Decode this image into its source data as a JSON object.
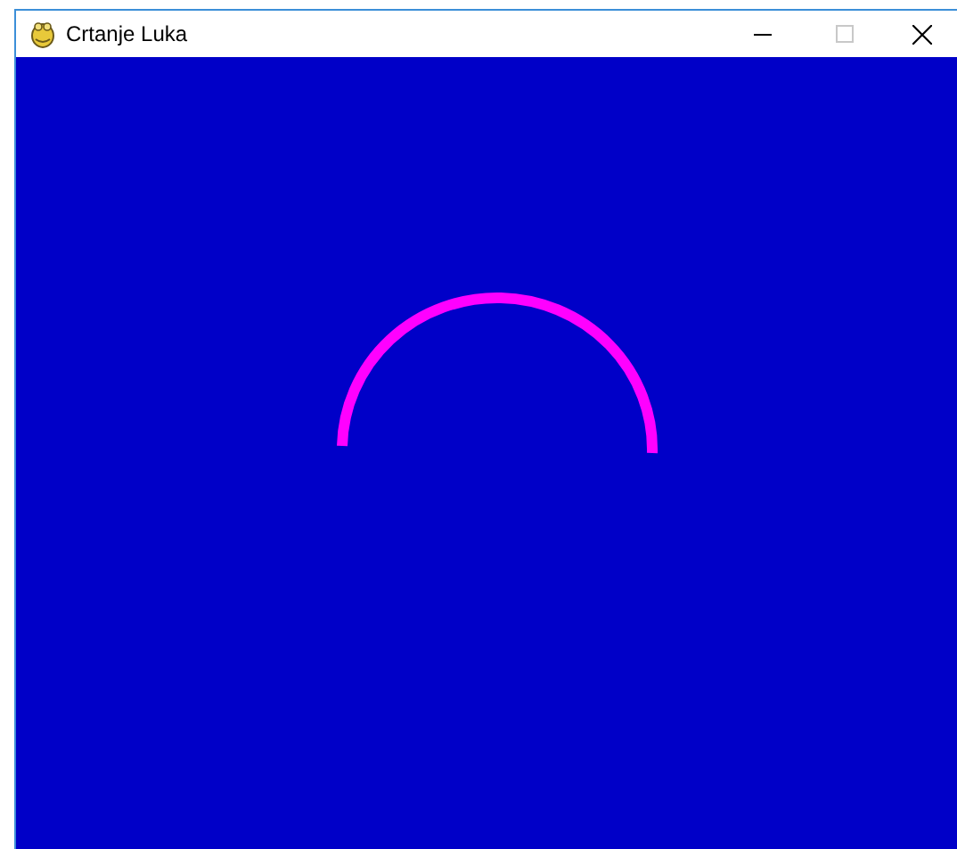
{
  "window": {
    "title": "Crtanje Luka"
  }
}
